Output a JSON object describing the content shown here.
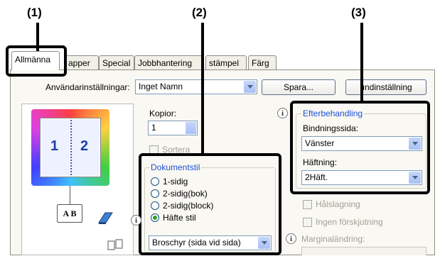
{
  "callouts": [
    "(1)",
    "(2)",
    "(3)"
  ],
  "tabs": [
    "Allmänna",
    "apper",
    "Special",
    "Jobbhantering",
    "stämpel",
    "Färg"
  ],
  "user_settings": {
    "label": "Användarinställningar:",
    "value": "Inget Namn",
    "save_label": "Spara...",
    "default_label": "undinställning"
  },
  "preview": {
    "page1": "1",
    "page2": "2",
    "book_label": "A B"
  },
  "copies": {
    "label": "Kopior:",
    "value": "1",
    "collate_label": "Sortera"
  },
  "document_style": {
    "title": "Dokumentstil",
    "options": [
      "1-sidig",
      "2-sidig(bok)",
      "2-sidig(block)",
      "Häfte stil"
    ],
    "selected": "Häfte stil",
    "booklet_value": "Broschyr (sida vid sida)"
  },
  "finishing": {
    "title": "Efterbehandling",
    "binding_label": "Bindningssida:",
    "binding_value": "Vänster",
    "staple_label": "Häftning:",
    "staple_value": "2Häft.",
    "punch_label": "Hålslagning",
    "no_offset_label": "Ingen förskjutning",
    "margin_label": "Marginaländring:"
  },
  "colors": {
    "group_title": "#1e4fd4",
    "radio_selected": "#2da12d",
    "combo_border": "#7f9db9"
  }
}
